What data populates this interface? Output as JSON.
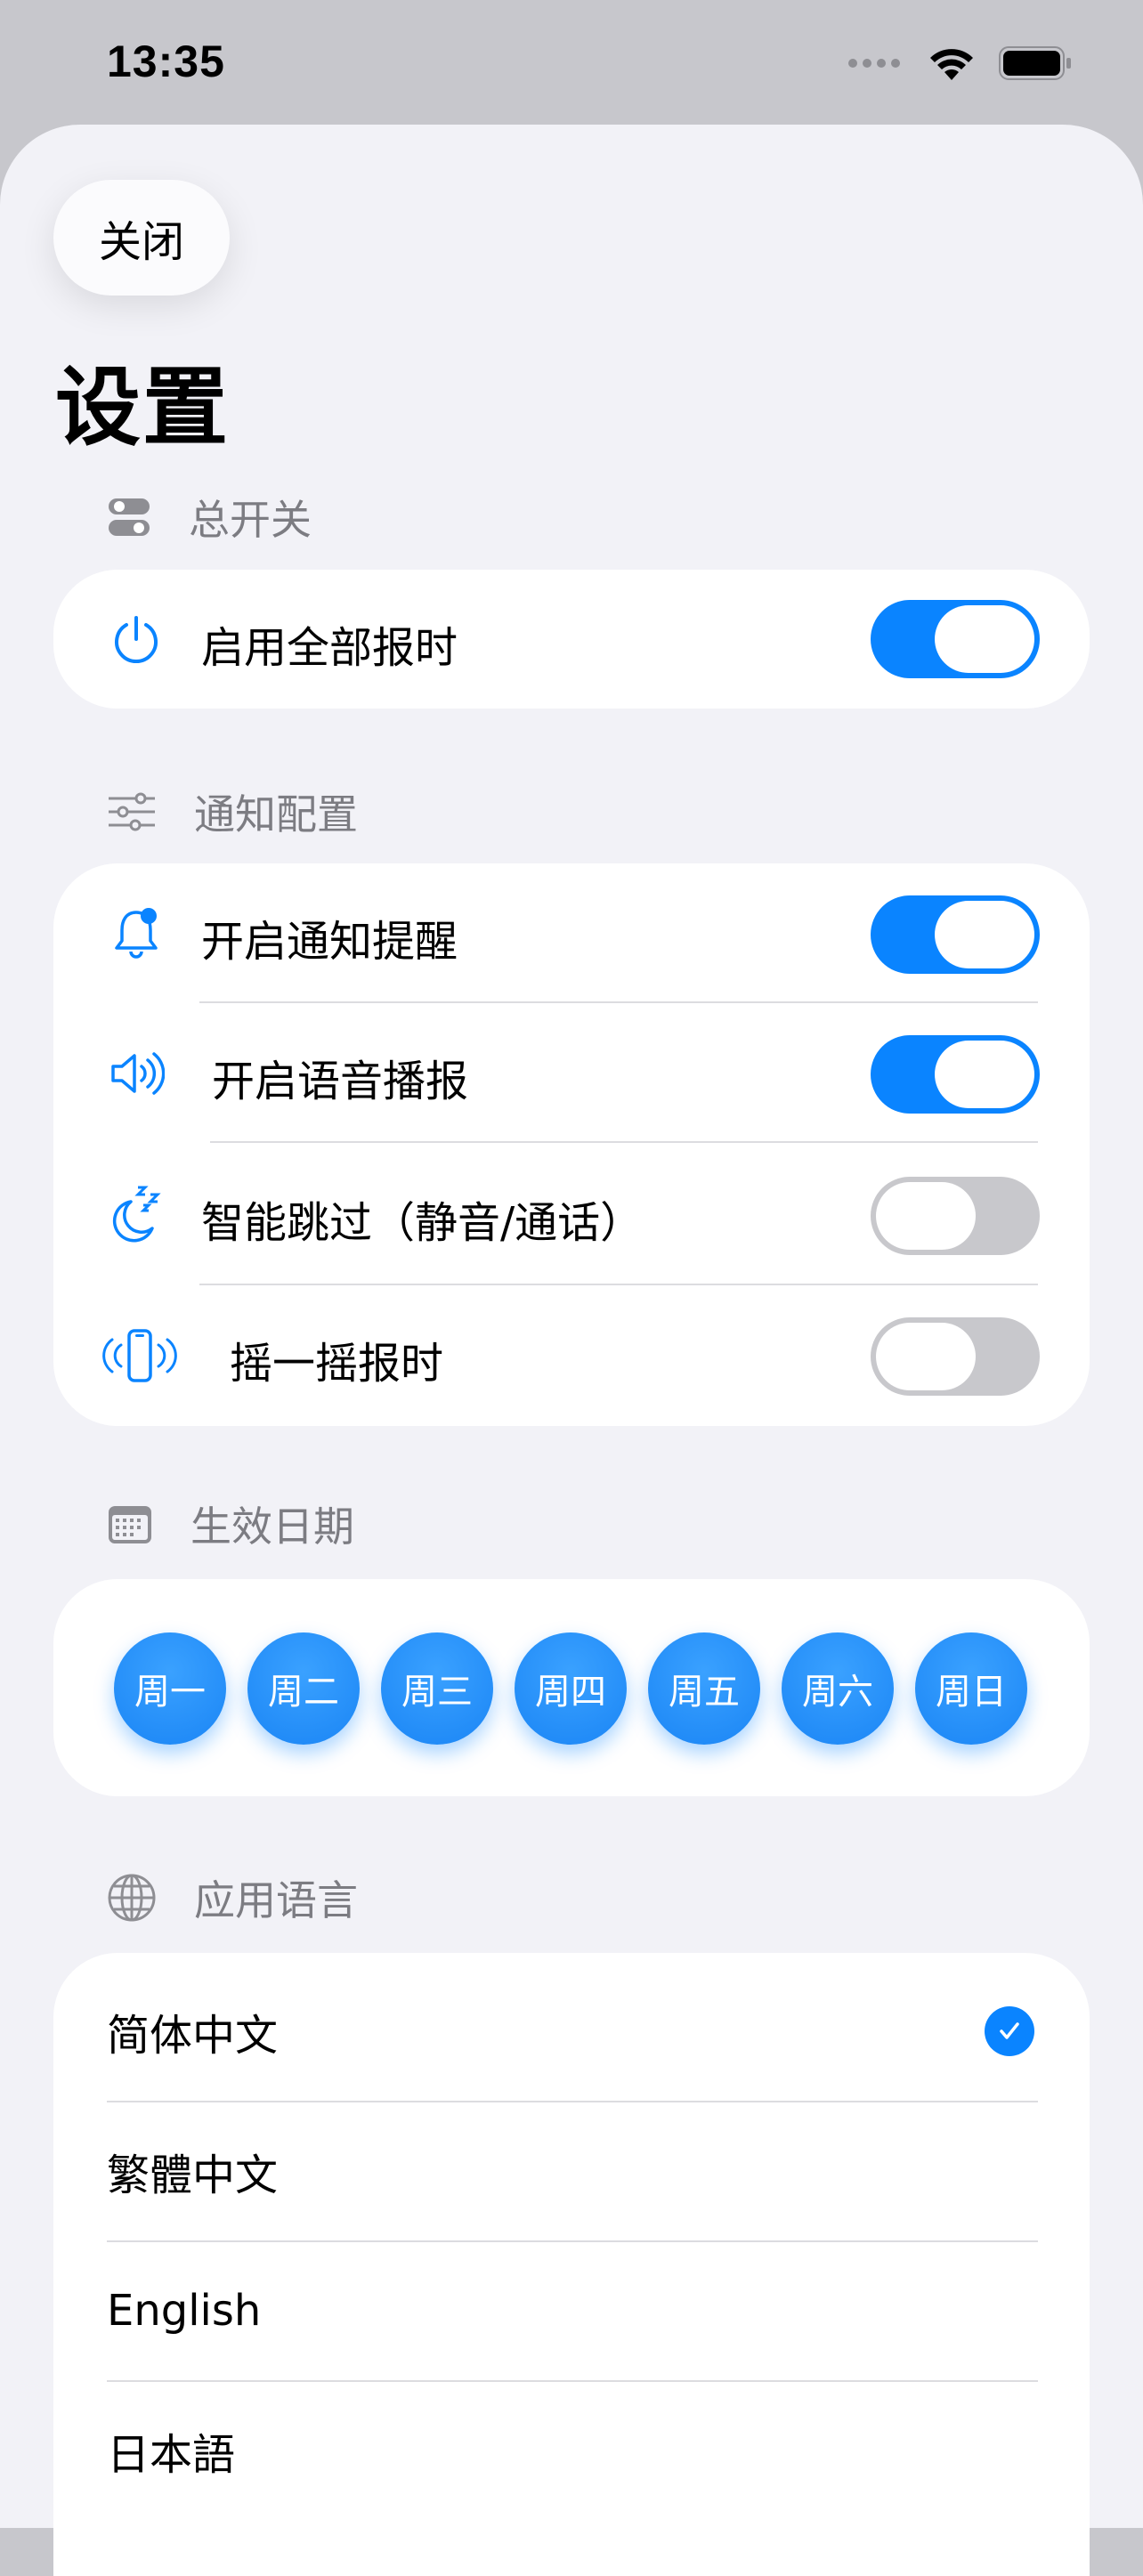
{
  "status_bar": {
    "time": "13:35"
  },
  "close_label": "关闭",
  "title": "设置",
  "sections": {
    "master": {
      "header": "总开关",
      "icon": "toggle-icon"
    },
    "notify": {
      "header": "通知配置",
      "icon": "sliders-icon"
    },
    "days": {
      "header": "生效日期",
      "icon": "calendar-icon"
    },
    "language": {
      "header": "应用语言",
      "icon": "globe-icon"
    }
  },
  "master": {
    "enable_all": {
      "label": "启用全部报时",
      "icon": "power-icon",
      "on": true
    }
  },
  "notify": {
    "items": [
      {
        "label": "开启通知提醒",
        "icon": "bell-badge-icon",
        "on": true
      },
      {
        "label": "开启语音播报",
        "icon": "speaker-wave-icon",
        "on": true
      },
      {
        "label": "智能跳过（静音/通话）",
        "icon": "moon-zzz-icon",
        "on": false
      },
      {
        "label": "摇一摇报时",
        "icon": "phone-shake-icon",
        "on": false
      }
    ]
  },
  "days": {
    "items": [
      {
        "label": "周一",
        "selected": true
      },
      {
        "label": "周二",
        "selected": true
      },
      {
        "label": "周三",
        "selected": true
      },
      {
        "label": "周四",
        "selected": true
      },
      {
        "label": "周五",
        "selected": true
      },
      {
        "label": "周六",
        "selected": true
      },
      {
        "label": "周日",
        "selected": true
      }
    ]
  },
  "language": {
    "items": [
      {
        "label": "简体中文",
        "selected": true
      },
      {
        "label": "繁體中文",
        "selected": false
      },
      {
        "label": "English",
        "selected": false
      },
      {
        "label": "日本語",
        "selected": false
      }
    ]
  },
  "colors": {
    "accent": "#0a84ff",
    "toggle_off": "#c8c8cc",
    "background": "#f2f2f7"
  }
}
